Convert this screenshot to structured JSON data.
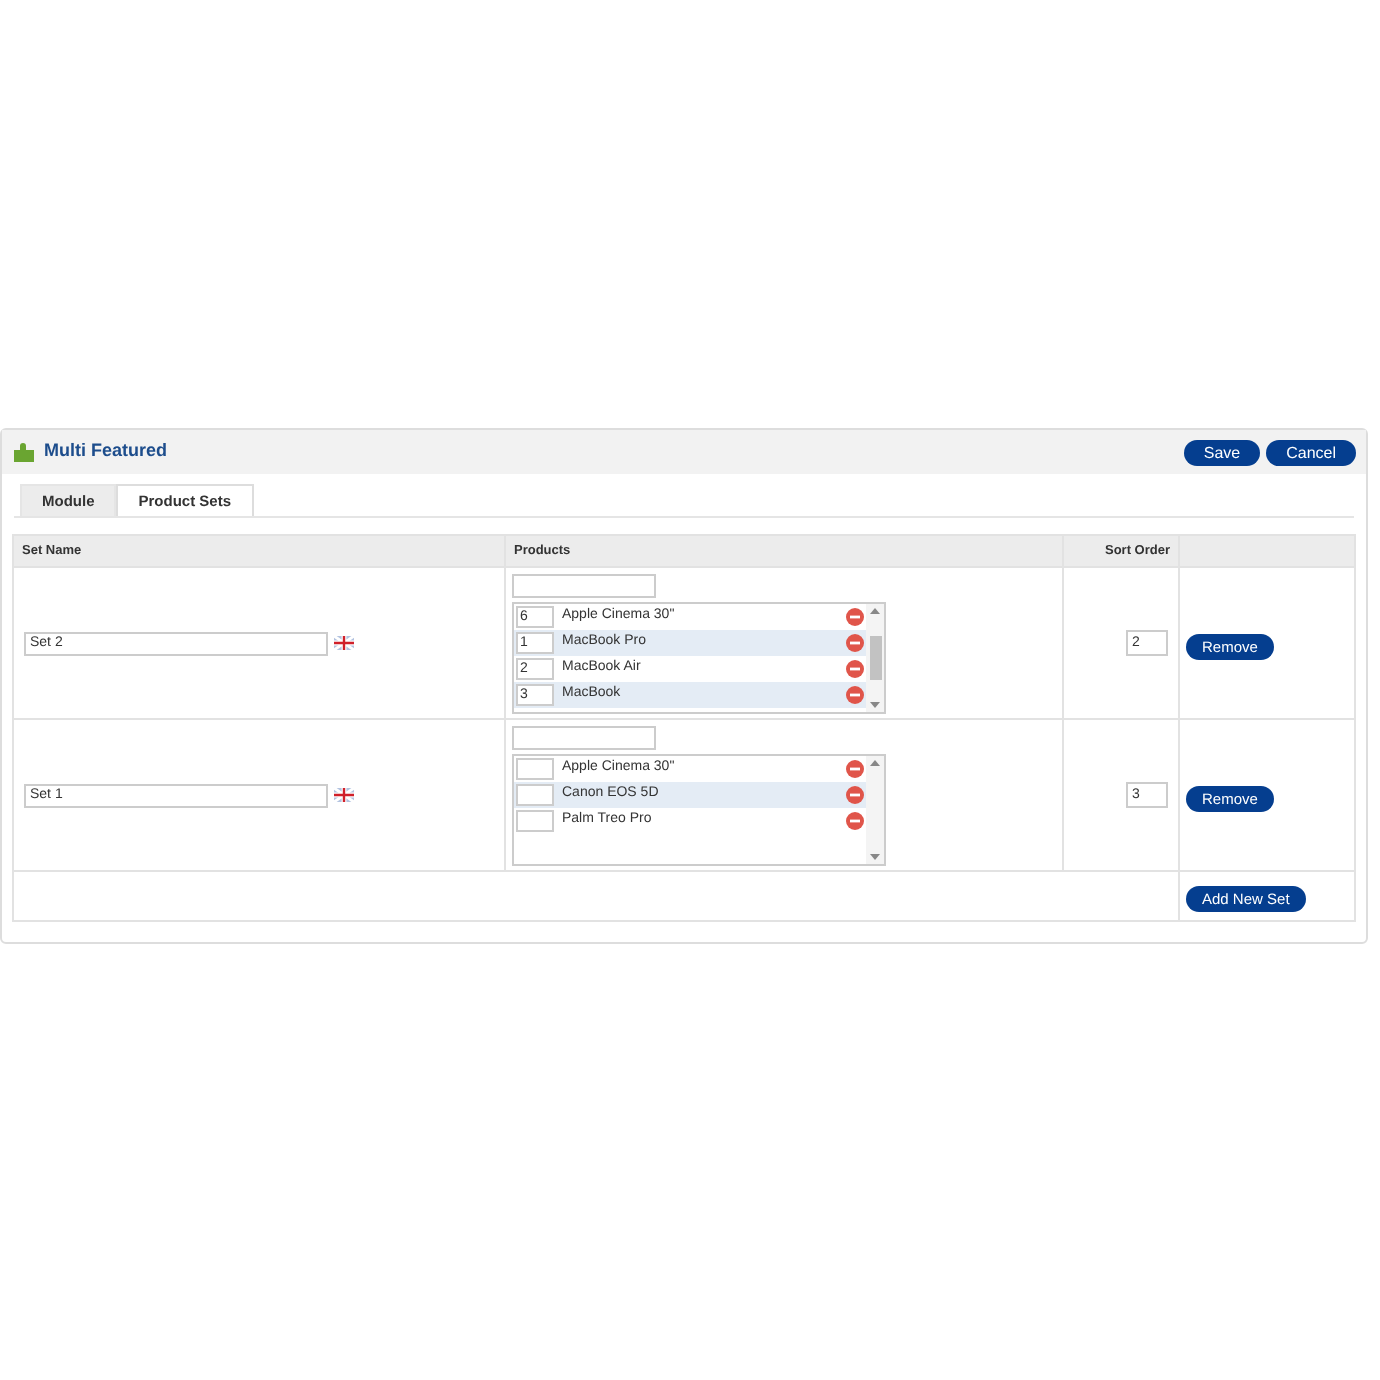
{
  "module": {
    "title": "Multi Featured",
    "buttons": [
      "Save",
      "Cancel"
    ]
  },
  "tabs": [
    {
      "label": "Module",
      "selected": false
    },
    {
      "label": "Product Sets",
      "selected": true
    }
  ],
  "table": {
    "columns": [
      "Set Name",
      "Products",
      "Sort Order"
    ],
    "rows": [
      {
        "set_name": "Set 2",
        "sort_order": "2",
        "action": "Remove",
        "scrollable": true,
        "products": [
          {
            "order": "6",
            "name": "Apple Cinema 30\""
          },
          {
            "order": "1",
            "name": "MacBook Pro"
          },
          {
            "order": "2",
            "name": "MacBook Air"
          },
          {
            "order": "3",
            "name": "MacBook"
          }
        ]
      },
      {
        "set_name": "Set 1",
        "sort_order": "3",
        "action": "Remove",
        "scrollable": false,
        "products": [
          {
            "name": "Apple Cinema 30\""
          },
          {
            "name": "Canon EOS 5D"
          },
          {
            "name": "Palm Treo Pro"
          }
        ]
      }
    ],
    "footer_button": "Add New Set"
  }
}
